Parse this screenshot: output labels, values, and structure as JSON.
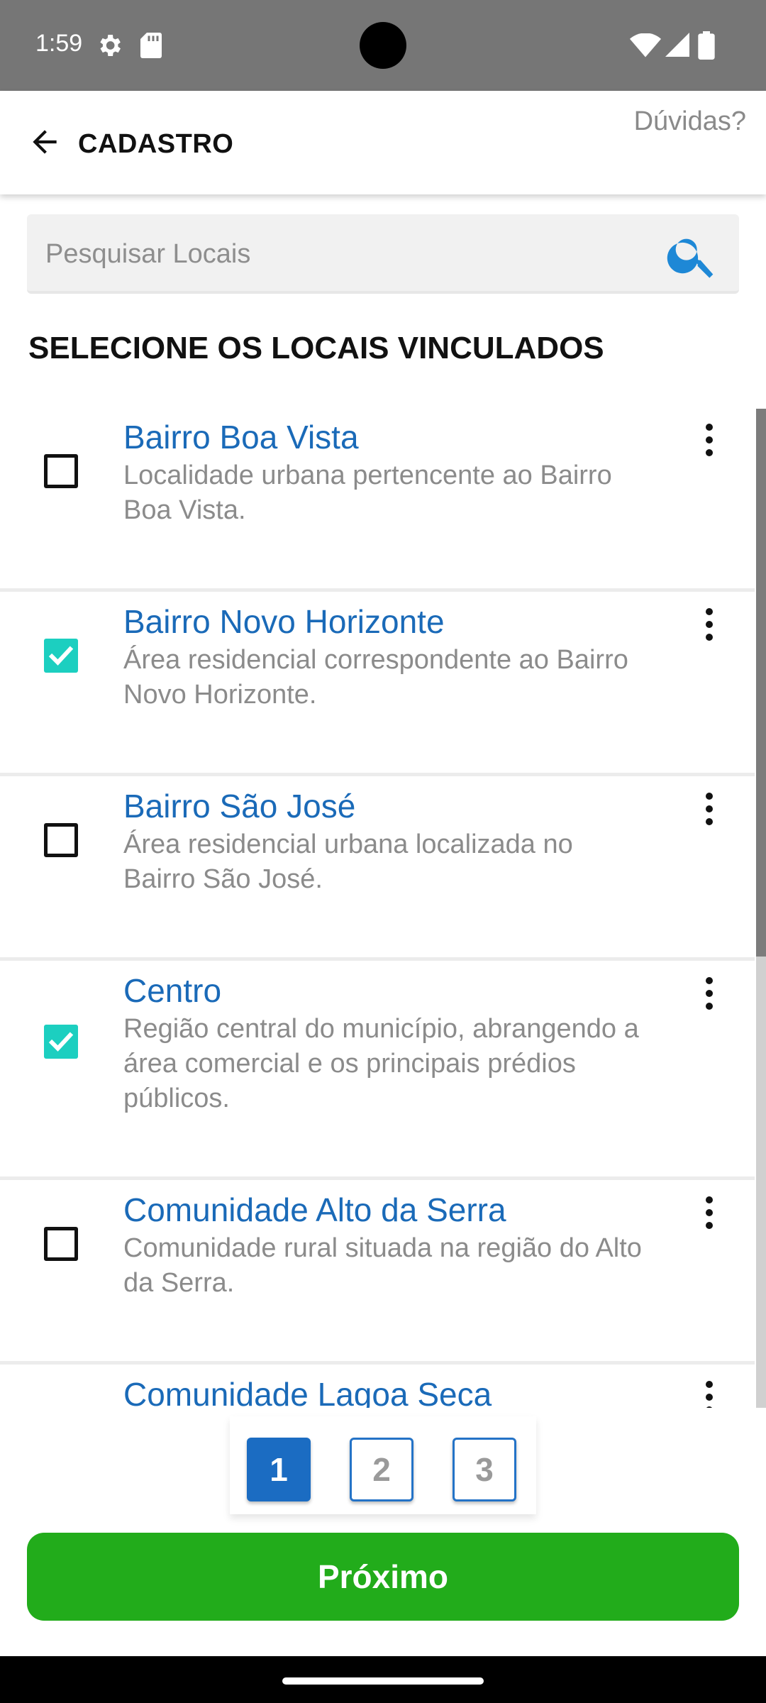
{
  "status_bar": {
    "time": "1:59",
    "icons": [
      "gear-icon",
      "sd-card-icon",
      "wifi-icon",
      "signal-icon",
      "battery-icon"
    ]
  },
  "app_bar": {
    "title": "CADASTRO",
    "help_label": "Dúvidas?"
  },
  "search": {
    "placeholder": "Pesquisar Locais",
    "value": ""
  },
  "section_title": "SELECIONE OS LOCAIS VINCULADOS",
  "items": [
    {
      "title": "Bairro Boa Vista",
      "description": "Localidade urbana pertencente ao Bairro Boa Vista.",
      "checked": false
    },
    {
      "title": "Bairro Novo Horizonte",
      "description": "Área residencial correspondente ao Bairro Novo Horizonte.",
      "checked": true
    },
    {
      "title": "Bairro São José",
      "description": "Área residencial urbana localizada no Bairro São José.",
      "checked": false
    },
    {
      "title": "Centro",
      "description": "Região central do município, abrangendo a área comercial e os principais prédios públicos.",
      "checked": true
    },
    {
      "title": "Comunidade Alto da Serra",
      "description": "Comunidade rural situada na região do Alto da Serra.",
      "checked": false
    },
    {
      "title": "Comunidade Lagoa Seca",
      "description": "",
      "checked": false
    }
  ],
  "pagination": {
    "pages": [
      "1",
      "2",
      "3"
    ],
    "current": "1"
  },
  "next_button_label": "Próximo",
  "colors": {
    "accent_blue": "#1a6ab8",
    "check_teal": "#1ccfc0",
    "next_green": "#22ac1b",
    "status_gray": "#767676"
  }
}
